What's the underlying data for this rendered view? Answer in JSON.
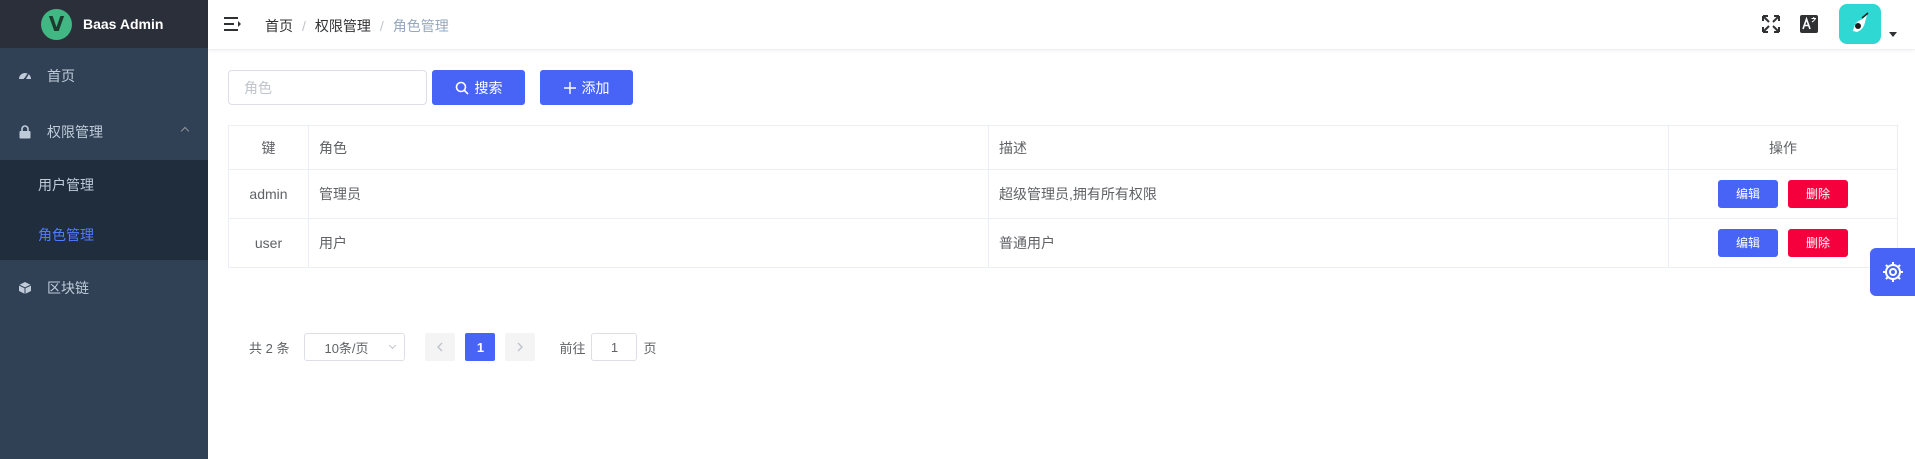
{
  "app": {
    "title": "Baas Admin",
    "logo_letter": "V"
  },
  "sidebar": {
    "items": [
      {
        "label": "首页",
        "icon": "dashboard-icon"
      },
      {
        "label": "权限管理",
        "icon": "lock-icon",
        "expanded": true,
        "children": [
          {
            "label": "用户管理"
          },
          {
            "label": "角色管理",
            "active": true
          }
        ]
      },
      {
        "label": "区块链",
        "icon": "cube-icon"
      }
    ]
  },
  "header": {
    "breadcrumb": [
      "首页",
      "权限管理",
      "角色管理"
    ],
    "separator": "/"
  },
  "toolbar": {
    "search_placeholder": "角色",
    "search_button": "搜索",
    "add_button": "添加"
  },
  "table": {
    "columns": [
      "键",
      "角色",
      "描述",
      "操作"
    ],
    "rows": [
      {
        "key": "admin",
        "role": "管理员",
        "desc": "超级管理员,拥有所有权限"
      },
      {
        "key": "user",
        "role": "用户",
        "desc": "普通用户"
      }
    ],
    "edit_label": "编辑",
    "delete_label": "删除"
  },
  "pagination": {
    "total_text": "共 2 条",
    "page_size": "10条/页",
    "current_page": "1",
    "goto_prefix": "前往",
    "goto_value": "1",
    "goto_suffix": "页"
  },
  "colors": {
    "primary": "#4764f6",
    "danger": "#f5003c",
    "sidebar_bg": "#304156",
    "active_menu": "#4f7dff"
  }
}
